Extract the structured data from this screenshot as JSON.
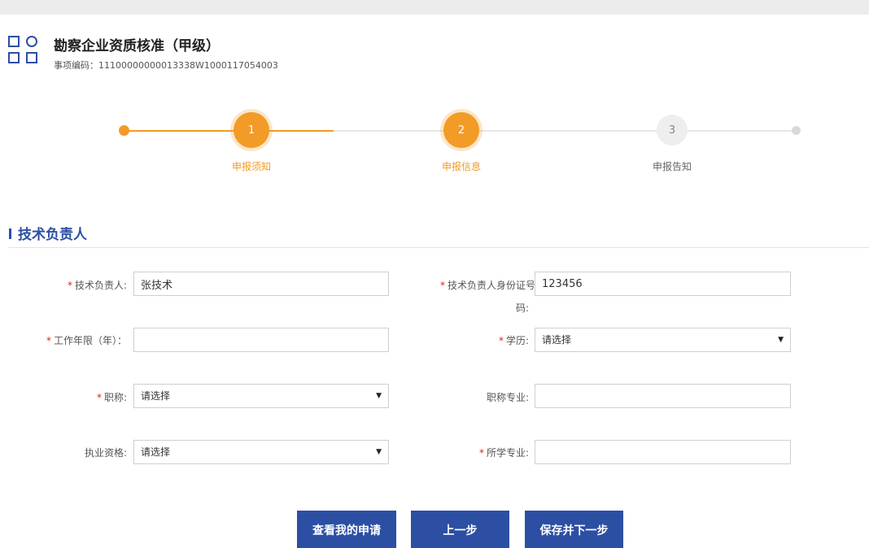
{
  "header": {
    "title": "勘察企业资质核准（甲级）",
    "code_text": "事项编码：11100000000013338W1000117054003"
  },
  "stepper": {
    "steps": [
      {
        "number": "1",
        "label": "申报须知"
      },
      {
        "number": "2",
        "label": "申报信息"
      },
      {
        "number": "3",
        "label": "申报告知"
      }
    ],
    "current_step": 2
  },
  "section": {
    "title": "技术负责人"
  },
  "form": {
    "tech_lead": {
      "label": "技术负责人:",
      "value": "张技术"
    },
    "id_number": {
      "label_line1": "技术负责人身份证号",
      "label_line2": "码:",
      "value": "123456"
    },
    "work_years": {
      "label": "工作年限（年）：",
      "value": ""
    },
    "education": {
      "label": "学历:",
      "value": "请选择"
    },
    "title_rank": {
      "label": "职称:",
      "value": "请选择"
    },
    "title_major": {
      "label": "职称专业:",
      "value": ""
    },
    "practice_qual": {
      "label": "执业资格:",
      "value": "请选择"
    },
    "study_major": {
      "label": "所学专业:",
      "value": ""
    },
    "required_mark": "*"
  },
  "buttons": {
    "view_applications": "查看我的申请",
    "previous": "上一步",
    "save_next": "保存并下一步"
  },
  "colors": {
    "accent": "#f29b26",
    "primary": "#2c4fa3",
    "required": "#e02020"
  }
}
